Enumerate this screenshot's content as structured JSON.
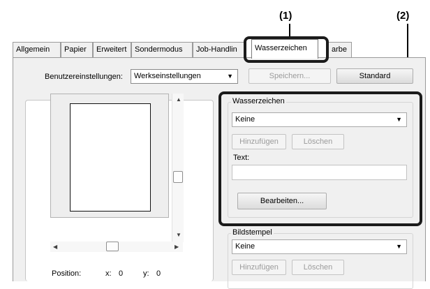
{
  "callouts": {
    "one": "(1)",
    "two": "(2)"
  },
  "tabs": [
    {
      "label": "Allgemein"
    },
    {
      "label": "Papier"
    },
    {
      "label": "Erweitert"
    },
    {
      "label": "Sondermodus"
    },
    {
      "label": "Job-Handlin"
    },
    {
      "label": "Wasserzeichen"
    },
    {
      "label": "arbe"
    }
  ],
  "user_settings": {
    "label": "Benutzereinstellungen:",
    "value": "Werkseinstellungen",
    "save_button": "Speichern...",
    "standard_button": "Standard"
  },
  "watermark": {
    "group_label": "Wasserzeichen",
    "select_value": "Keine",
    "add_button": "Hinzufügen",
    "delete_button": "Löschen",
    "text_label": "Text:",
    "text_value": "",
    "edit_button": "Bearbeiten..."
  },
  "image_stamp": {
    "group_label": "Bildstempel",
    "select_value": "Keine",
    "add_button": "Hinzufügen",
    "delete_button": "Löschen"
  },
  "position": {
    "label": "Position:",
    "x_label": "x:",
    "x_value": "0",
    "y_label": "y:",
    "y_value": "0"
  },
  "icons": {
    "dropdown": "chevron-down-icon",
    "scroll_up": "arrow-up-icon",
    "scroll_down": "arrow-down-icon",
    "scroll_left": "arrow-left-icon",
    "scroll_right": "arrow-right-icon"
  },
  "colors": {
    "highlight": "#1b1b1b",
    "dialog_bg": "#f0f0f0"
  }
}
